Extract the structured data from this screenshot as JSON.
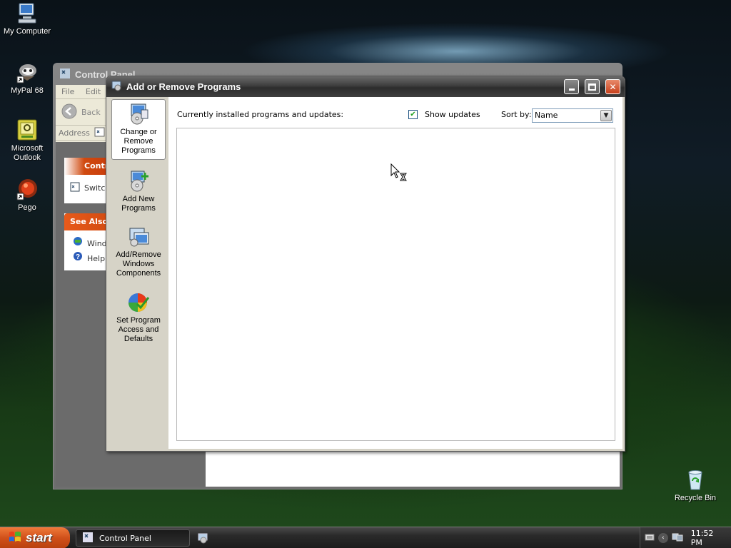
{
  "desktop": {
    "icons": [
      {
        "label": "My Computer",
        "icon": "computer-icon"
      },
      {
        "label": "MyPal 68",
        "icon": "mypal-browser-icon"
      },
      {
        "label": "Microsoft Outlook",
        "icon": "outlook-icon"
      },
      {
        "label": "Pego",
        "icon": "pego-icon"
      },
      {
        "label": "Recycle Bin",
        "icon": "recycle-bin-icon"
      }
    ]
  },
  "control_panel": {
    "title": "Control Panel",
    "menu": [
      "File",
      "Edit"
    ],
    "back_label": "Back",
    "address_label": "Address",
    "panel_header": "Contr",
    "switch_label": "Switc",
    "see_also_header": "See Also",
    "see_also_items": [
      "Windo",
      "Help"
    ]
  },
  "arp": {
    "title": "Add or Remove Programs",
    "sidebar": [
      {
        "label": "Change or Remove Programs",
        "icon": "change-remove-programs-icon",
        "active": true
      },
      {
        "label": "Add New Programs",
        "icon": "add-new-programs-icon",
        "active": false
      },
      {
        "label": "Add/Remove Windows Components",
        "icon": "windows-components-icon",
        "active": false
      },
      {
        "label": "Set Program Access and Defaults",
        "icon": "program-defaults-icon",
        "active": false
      }
    ],
    "installed_label": "Currently installed programs and updates:",
    "show_updates_label": "Show updates",
    "show_updates_checked": true,
    "sort_by_label": "Sort by:",
    "sort_by_value": "Name"
  },
  "taskbar": {
    "start_label": "start",
    "task_button_label": "Control Panel",
    "clock": "11:52 PM"
  }
}
